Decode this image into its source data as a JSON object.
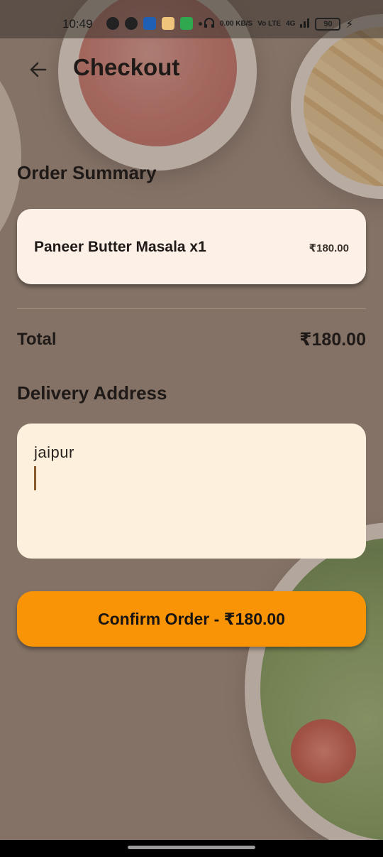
{
  "status_bar": {
    "time": "10:49",
    "icons": [
      "whatsapp-icon",
      "snapchat-icon",
      "app-icon",
      "face-icon",
      "shield-icon"
    ],
    "network_speed": "0.00 KB/S",
    "volte": "Vo LTE",
    "signal": "4G",
    "battery": "90"
  },
  "header": {
    "title": "Checkout",
    "back_icon": "arrow-left-icon"
  },
  "order_summary": {
    "title": "Order Summary",
    "items": [
      {
        "name": "Paneer Butter Masala x1",
        "price": "₹180.00"
      }
    ]
  },
  "total": {
    "label": "Total",
    "value": "₹180.00"
  },
  "delivery": {
    "title": "Delivery Address",
    "address_value": "jaipur"
  },
  "confirm_button": {
    "label": "Confirm Order - ₹180.00"
  },
  "colors": {
    "accent": "#f89406",
    "card": "#fcf0e7",
    "input": "#fdf0dc",
    "text": "#1f1a17"
  }
}
